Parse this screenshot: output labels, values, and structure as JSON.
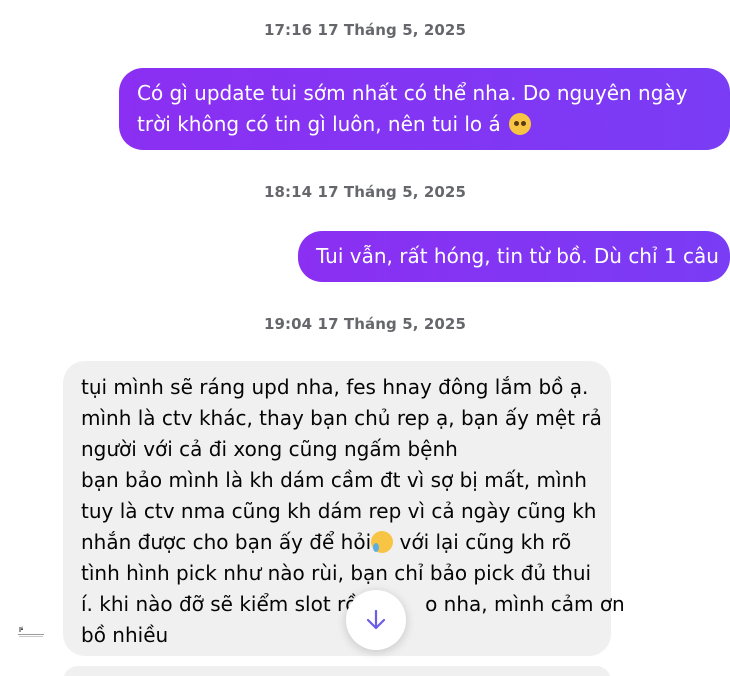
{
  "colors": {
    "outgoing_bubble": "#8a2cf2",
    "incoming_bubble": "#f0f0f0",
    "timestamp": "#65676b",
    "scroll_arrow": "#6b5ce7"
  },
  "messages": [
    {
      "type": "timestamp",
      "text": "17:16 17 Tháng 5, 2025"
    },
    {
      "type": "outgoing",
      "lines": [
        "Có gì update tui sớm nhất có thể nha. Do nguyên ngày",
        "trời không có tin gì luôn, nên tui lo á"
      ],
      "emoji": "flushed-face-icon"
    },
    {
      "type": "timestamp",
      "text": "18:14 17 Tháng 5, 2025"
    },
    {
      "type": "outgoing",
      "lines": [
        "Tui vẫn, rất hóng, tin từ bồ. Dù chỉ 1 câu"
      ]
    },
    {
      "type": "timestamp",
      "text": "19:04 17 Tháng 5, 2025"
    },
    {
      "type": "incoming",
      "lines": [
        "tụi mình sẽ ráng upd nha, fes hnay đông lắm bồ ạ.",
        "mình là ctv khác, thay bạn chủ rep ạ, bạn ấy mệt rả",
        "người với cả đi xong cũng ngấm bệnh",
        "bạn bảo mình là kh dám cầm đt vì sợ bị mất, mình",
        "tuy là ctv nma cũng kh dám rep vì cả ngày cũng kh",
        "nhắn được cho bạn ấy để hỏi",
        "với lại cũng kh rõ",
        "tình hình pick như nào rùi, bạn chỉ bảo pick đủ thui",
        "í. khi nào đỡ sẽ kiểm slot rồi",
        "o nha, mình cảm ơn",
        "bồ nhiều"
      ],
      "emoji": "sad-tear-face-icon"
    }
  ],
  "scroll_button": {
    "icon": "arrow-down-icon"
  }
}
